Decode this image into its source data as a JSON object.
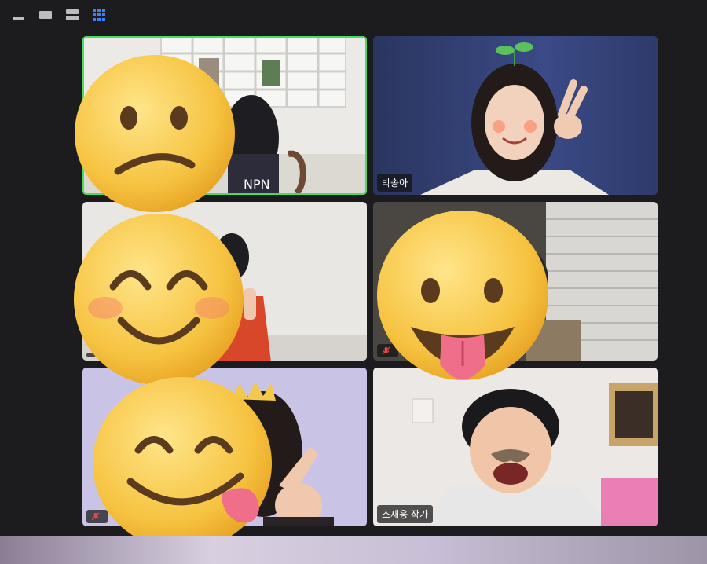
{
  "toolbar": {
    "icons": [
      "minimize-icon",
      "single-view-icon",
      "split-view-icon",
      "gallery-view-icon"
    ]
  },
  "participants": [
    {
      "name": "",
      "muted": false,
      "active": true
    },
    {
      "name": "박송아",
      "muted": false,
      "active": false
    },
    {
      "name": "",
      "muted": false,
      "active": false
    },
    {
      "name": "",
      "muted": true,
      "active": false
    },
    {
      "name": "",
      "muted": true,
      "active": false
    },
    {
      "name": "소재웅 작가",
      "muted": false,
      "active": false
    }
  ],
  "colors": {
    "background": "#1c1c1e",
    "active_speaker_border": "#4cd964",
    "gallery_icon": "#3b82f6",
    "emoji_face": "#f6c340"
  }
}
